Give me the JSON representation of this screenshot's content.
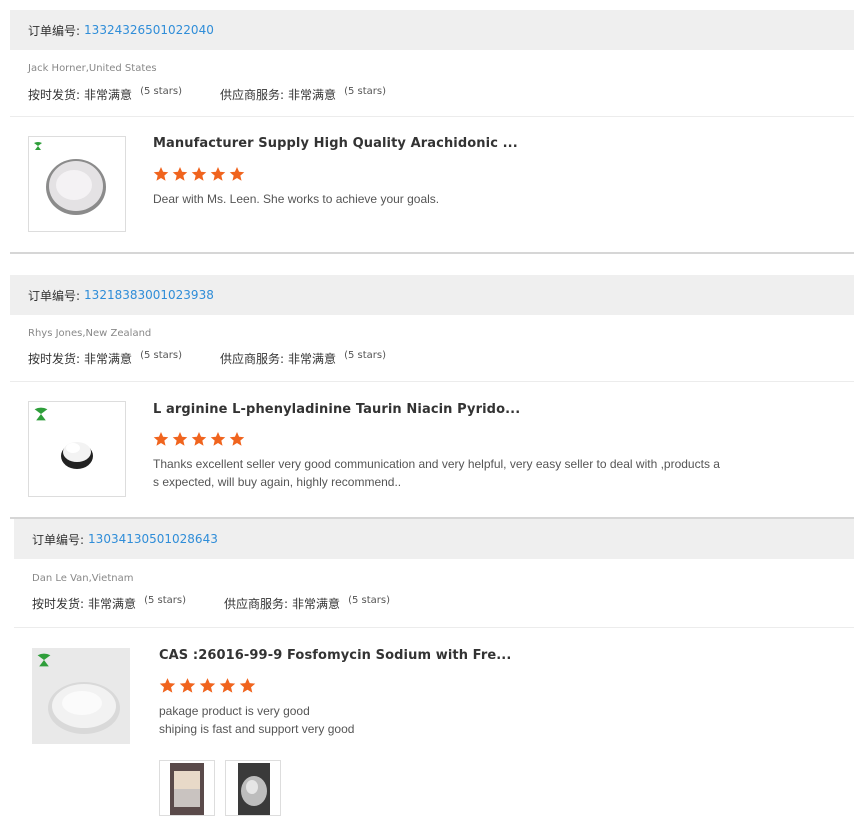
{
  "labels": {
    "order_no": "订单编号:",
    "on_time": "按时发货:",
    "supplier_service": "供应商服务:"
  },
  "reviews": [
    {
      "order_number": "13324326501022040",
      "buyer": "Jack Horner,United States",
      "on_time_value": "非常满意",
      "on_time_stars": "(5 stars)",
      "service_value": "非常满意",
      "service_stars": "(5 stars)",
      "product_title": "Manufacturer Supply High Quality Arachidonic ...",
      "rating": 5,
      "comment_lines": [
        "Dear with Ms. Leen. She works to achieve your goals."
      ]
    },
    {
      "order_number": "13218383001023938",
      "buyer": "Rhys Jones,New Zealand",
      "on_time_value": "非常满意",
      "on_time_stars": "(5 stars)",
      "service_value": "非常满意",
      "service_stars": "(5 stars)",
      "product_title": "L arginine L-phenyladinine Taurin Niacin Pyrido...",
      "rating": 5,
      "comment_lines": [
        "Thanks excellent seller very good communication and very helpful, very easy seller to deal with ,products a",
        "s expected, will buy again, highly recommend.."
      ]
    },
    {
      "order_number": "13034130501028643",
      "buyer": "Dan Le Van,Vietnam",
      "on_time_value": "非常满意",
      "on_time_stars": "(5 stars)",
      "service_value": "非常满意",
      "service_stars": "(5 stars)",
      "product_title": "CAS :26016-99-9 Fosfomycin Sodium with Fre...",
      "rating": 5,
      "comment_lines": [
        "pakage product is very good",
        "shiping is fast and support very good"
      ]
    }
  ],
  "colors": {
    "star": "#f0641e",
    "link": "#2f8dd8",
    "header_bg": "#efefef"
  }
}
